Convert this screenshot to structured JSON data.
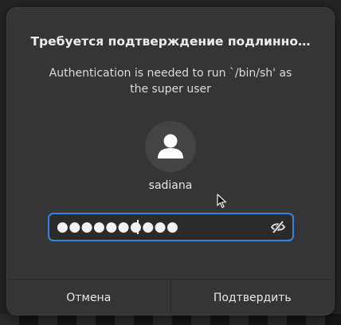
{
  "dialog": {
    "title": "Требуется подтверждение подлинно…",
    "message": "Authentication is needed to run `/bin/sh' as the super user",
    "user": {
      "name": "sadiana",
      "avatar_icon": "user-silhouette-icon"
    },
    "password": {
      "masked_value": "●●●●●●●●●●",
      "reveal_icon": "eye-slash-icon"
    },
    "buttons": {
      "cancel_label": "Отмена",
      "confirm_label": "Подтвердить"
    }
  },
  "colors": {
    "dialog_bg": "#353535",
    "focus_border": "#3584e4",
    "text": "#ececec"
  }
}
